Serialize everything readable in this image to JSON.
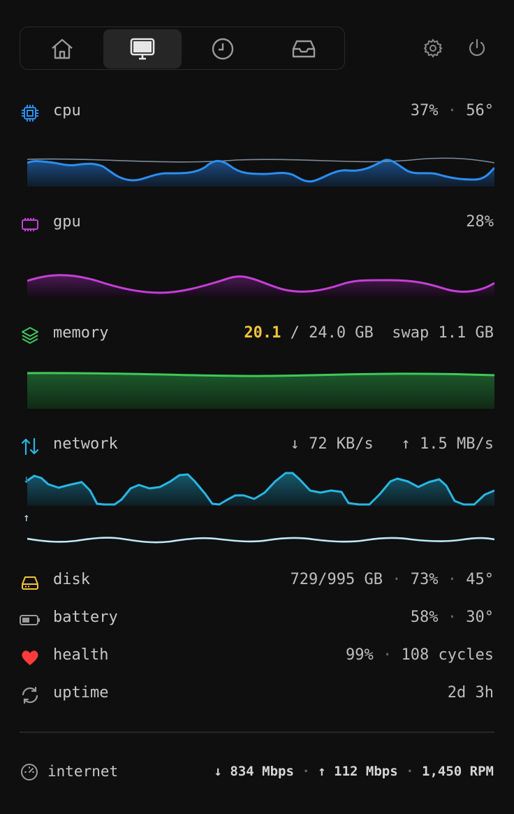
{
  "tabs": [
    {
      "name": "home",
      "icon": "home-icon",
      "active": false
    },
    {
      "name": "system",
      "icon": "monitor-icon",
      "active": true
    },
    {
      "name": "history",
      "icon": "clock-icon",
      "active": false
    },
    {
      "name": "inbox",
      "icon": "inbox-icon",
      "active": false
    }
  ],
  "toolbar": {
    "settings_icon": "gear-icon",
    "power_icon": "power-icon"
  },
  "cpu": {
    "label": "cpu",
    "usage": "37%",
    "sep": "·",
    "temp": "56°",
    "color": "#2b8ef0"
  },
  "gpu": {
    "label": "gpu",
    "usage": "28%",
    "color": "#c63fd8"
  },
  "memory": {
    "label": "memory",
    "used": "20.1",
    "total": " / 24.0 GB",
    "swap": "swap 1.1 GB",
    "color": "#3ec95b"
  },
  "network": {
    "label": "network",
    "down": "↓ 72 KB/s",
    "up": "↑ 1.5 MB/s",
    "down_arrow": "↓",
    "up_arrow": "↑",
    "down_color": "#29b6e3",
    "up_color": "#bfe9f7"
  },
  "disk": {
    "label": "disk",
    "value": "729/995 GB",
    "sep1": "·",
    "pct": "73%",
    "sep2": "·",
    "temp": "45°",
    "color": "#f5c33b"
  },
  "battery": {
    "label": "battery",
    "pct": "58%",
    "sep": "·",
    "temp": "30°"
  },
  "health": {
    "label": "health",
    "pct": "99%",
    "sep": "·",
    "cycles": "108 cycles",
    "color": "#ff3b3b"
  },
  "uptime": {
    "label": "uptime",
    "value": "2d 3h"
  },
  "footer": {
    "label": "internet",
    "down": "↓ 834 Mbps",
    "sep1": "·",
    "up": "↑ 112 Mbps",
    "sep2": "·",
    "rpm": "1,450 RPM"
  }
}
